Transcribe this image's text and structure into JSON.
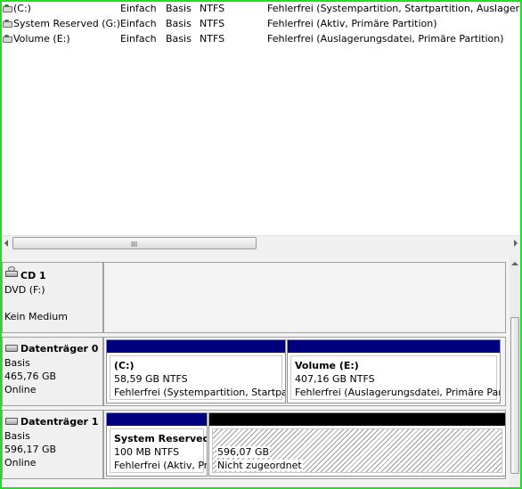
{
  "volumes": [
    {
      "name": " (C:)",
      "layout": "Einfach",
      "type": "Basis",
      "fs": "NTFS",
      "status": "Fehlerfrei (Systempartition, Startpartition, Auslagerungsda"
    },
    {
      "name": "System Reserved (G:)",
      "layout": "Einfach",
      "type": "Basis",
      "fs": "NTFS",
      "status": "Fehlerfrei (Aktiv, Primäre Partition)"
    },
    {
      "name": "Volume (E:)",
      "layout": "Einfach",
      "type": "Basis",
      "fs": "NTFS",
      "status": "Fehlerfrei (Auslagerungsdatei, Primäre Partition)"
    }
  ],
  "hscroll": {
    "grip": "III"
  },
  "disks": [
    {
      "title": "CD 1",
      "lines": [
        "DVD (F:)",
        "",
        "Kein Medium"
      ],
      "icon": "cd-drive-icon"
    },
    {
      "title": "Datenträger 0",
      "lines": [
        "Basis",
        "465,76 GB",
        "Online"
      ],
      "icon": "hard-disk-icon",
      "partitions": [
        {
          "name": "(C:)",
          "size": "58,59 GB NTFS",
          "status": "Fehlerfrei (Systempartition, Startpar",
          "bar_color": "#00007f"
        },
        {
          "name": "Volume  (E:)",
          "size": "407,16 GB NTFS",
          "status": "Fehlerfrei (Auslagerungsdatei, Primäre Parl",
          "bar_color": "#00007f"
        }
      ]
    },
    {
      "title": "Datenträger 1",
      "lines": [
        "Basis",
        "596,17 GB",
        "Online"
      ],
      "icon": "hard-disk-icon",
      "partitions": [
        {
          "name": "System Reserved",
          "size": "100 MB NTFS",
          "status": "Fehlerfrei (Aktiv, Pr",
          "bar_color": "#00007f"
        },
        {
          "name": "",
          "size": "596,07 GB",
          "status": "Nicht zugeordnet",
          "bar_color": "#000000",
          "unallocated": true
        }
      ]
    }
  ],
  "colors": {
    "frame": "#1ee01e",
    "primary_bar": "#00007f",
    "unallocated_bar": "#000000"
  }
}
